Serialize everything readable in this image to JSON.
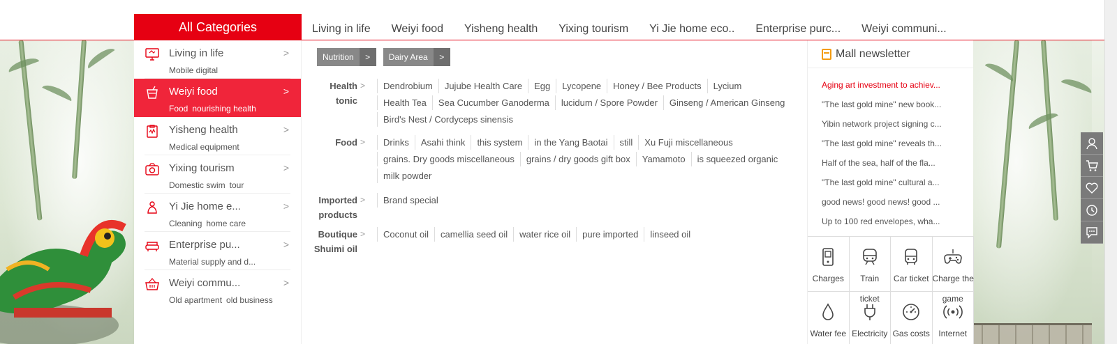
{
  "nav": {
    "all_categories": "All Categories",
    "items": [
      "Living in life",
      "Weiyi food",
      "Yisheng health",
      "Yixing tourism",
      "Yi Jie home eco..",
      "Enterprise purc...",
      "Weiyi communi..."
    ]
  },
  "categories": [
    {
      "icon": "monitor-icon",
      "name": "Living in life",
      "subs": [
        "Mobile digital"
      ]
    },
    {
      "icon": "cup-icon",
      "name": "Weiyi food",
      "subs": [
        "Food",
        "nourishing health"
      ]
    },
    {
      "icon": "clipboard-icon",
      "name": "Yisheng health",
      "subs": [
        "Medical equipment"
      ]
    },
    {
      "icon": "camera-icon",
      "name": "Yixing tourism",
      "subs": [
        "Domestic swim",
        "tour"
      ]
    },
    {
      "icon": "cleaner-icon",
      "name": "Yi Jie home e...",
      "subs": [
        "Cleaning",
        "home care"
      ]
    },
    {
      "icon": "sofa-icon",
      "name": "Enterprise pu...",
      "subs": [
        "Material supply and d..."
      ]
    },
    {
      "icon": "basket-icon",
      "name": "Weiyi commu...",
      "subs": [
        "Old apartment",
        "old business"
      ]
    }
  ],
  "submenu": {
    "tags": [
      {
        "label": "Nutrition",
        "arrow": ">"
      },
      {
        "label": "Dairy Area",
        "arrow": ">"
      }
    ],
    "sections": [
      {
        "title": "Health tonic",
        "arrow": ">",
        "links": [
          "Dendrobium",
          "Jujube Health Care",
          "Egg",
          "Lycopene",
          "Honey / Bee Products",
          "Lycium",
          "Health Tea",
          "Sea Cucumber Ganoderma",
          "lucidum / Spore Powder",
          "Ginseng / American Ginseng",
          "Bird's Nest / Cordyceps sinensis"
        ]
      },
      {
        "title": "Food",
        "arrow": ">",
        "links": [
          "Drinks",
          "Asahi think",
          "this system",
          "in the Yang Baotai",
          "still",
          "Xu Fuji miscellaneous",
          "grains. Dry goods miscellaneous",
          "grains / dry goods gift box",
          "Yamamoto",
          "is squeezed organic",
          "milk powder"
        ]
      },
      {
        "title": "Imported products",
        "arrow": ">",
        "links": [
          "Brand special"
        ]
      },
      {
        "title": "Boutique Shuimi oil",
        "arrow": ">",
        "links": [
          "Coconut oil",
          "camellia seed oil",
          "water rice oil",
          "pure imported",
          "linseed oil"
        ]
      }
    ]
  },
  "newsletter": {
    "title": "Mall newsletter",
    "icon": "notebook-icon",
    "items": [
      "Aging art investment to achiev...",
      "\"The last gold mine\" new book...",
      "Yibin network project signing c...",
      "\"The last gold mine\" reveals th...",
      "Half of the sea, half of the fla...",
      "\"The last gold mine\" cultural a...",
      "good news! good news! good ...",
      "Up to 100 red envelopes, wha..."
    ],
    "accent_color": "#e60012"
  },
  "services": [
    {
      "icon": "phone-icon",
      "label": "Charges",
      "label2": ""
    },
    {
      "icon": "train-icon",
      "label": "Train",
      "label2": "ticket"
    },
    {
      "icon": "bus-icon",
      "label": "Car ticket",
      "label2": ""
    },
    {
      "icon": "gamepad-icon",
      "label": "Charge the",
      "label2": "game"
    },
    {
      "icon": "water-drop-icon",
      "label": "Water fee",
      "label2": ""
    },
    {
      "icon": "plug-icon",
      "label": "Electricity",
      "label2": ""
    },
    {
      "icon": "gauge-icon",
      "label": "Gas costs",
      "label2": ""
    },
    {
      "icon": "signal-icon",
      "label": "Internet",
      "label2": ""
    }
  ],
  "toolbar": [
    "user-icon",
    "cart-icon",
    "heart-icon",
    "history-icon",
    "message-icon"
  ],
  "colors": {
    "brand_red": "#e60012",
    "active_red": "#f0253a"
  }
}
